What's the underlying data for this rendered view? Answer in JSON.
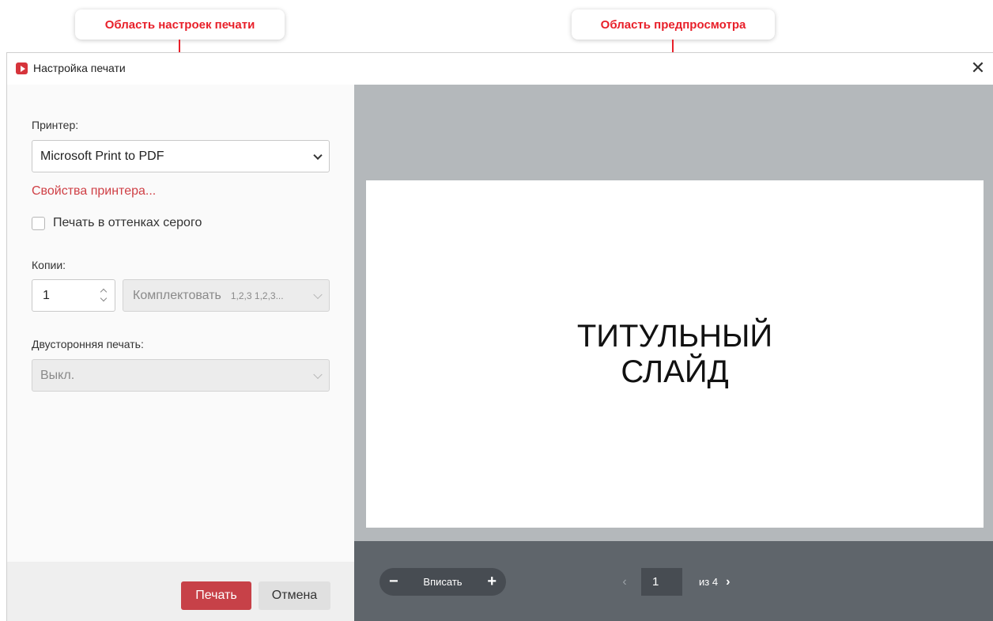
{
  "callouts": {
    "settings_area": "Область настроек печати",
    "preview_area": "Область предпросмотра"
  },
  "dialog": {
    "title": "Настройка печати",
    "close": "✕"
  },
  "settings": {
    "printer_label": "Принтер:",
    "printer_value": "Microsoft Print to PDF",
    "printer_properties": "Свойства принтера...",
    "grayscale_label": "Печать в оттенках серого",
    "grayscale_checked": false,
    "copies_label": "Копии:",
    "copies_value": "1",
    "collate_label": "Комплектовать",
    "collate_hint": "1,2,3 1,2,3...",
    "duplex_label": "Двусторонняя печать:",
    "duplex_value": "Выкл.",
    "print_button": "Печать",
    "cancel_button": "Отмена"
  },
  "preview": {
    "slide_title": "ТИТУЛЬНЫЙ СЛАЙД",
    "zoom_minus": "−",
    "zoom_fit": "Вписать",
    "zoom_plus": "+",
    "prev_page": "‹",
    "current_page": "1",
    "of_pages": "из 4",
    "next_page": "›"
  },
  "colors": {
    "accent": "#c74148",
    "callout_red": "#e8202a",
    "preview_bg": "#b4b8bb",
    "toolbar_bg": "#5f656b"
  }
}
